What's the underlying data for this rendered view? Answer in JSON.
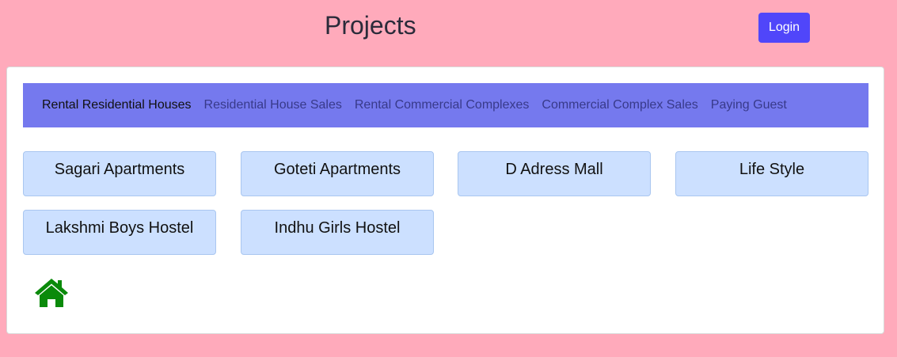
{
  "header": {
    "title": "Projects",
    "login_label": "Login"
  },
  "tabs": [
    {
      "label": "Rental Residential Houses",
      "active": true
    },
    {
      "label": "Residential House Sales",
      "active": false
    },
    {
      "label": "Rental Commercial Complexes",
      "active": false
    },
    {
      "label": "Commercial Complex Sales",
      "active": false
    },
    {
      "label": "Paying Guest",
      "active": false
    }
  ],
  "projects": [
    {
      "name": "Sagari Apartments"
    },
    {
      "name": "Goteti Apartments"
    },
    {
      "name": "D Adress Mall"
    },
    {
      "name": "Life Style"
    },
    {
      "name": "Lakshmi Boys Hostel"
    },
    {
      "name": "Indhu Girls Hostel"
    }
  ],
  "icons": {
    "home": "home-icon"
  },
  "colors": {
    "background": "#ffaabb",
    "accent": "#5046fa",
    "tabbar": "#7579ee",
    "tile": "#cce0ff",
    "home_icon": "#0a8a0a"
  }
}
